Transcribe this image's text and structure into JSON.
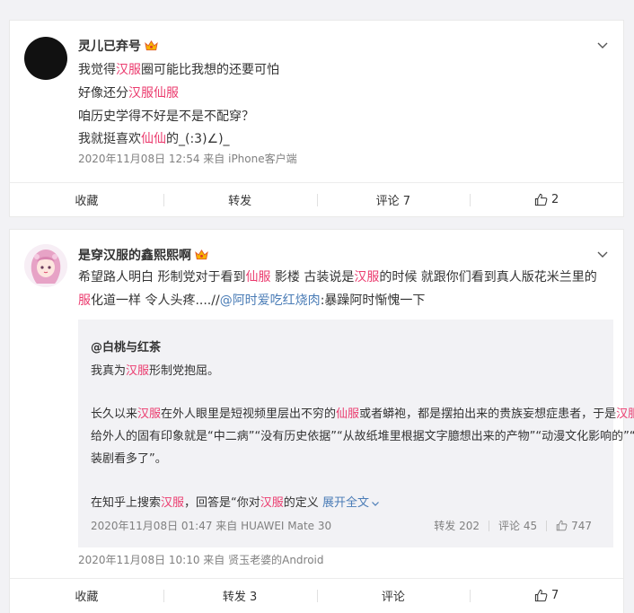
{
  "post1": {
    "username": "灵儿已弃号",
    "lines": [
      {
        "parts": [
          {
            "t": "我觉得"
          },
          {
            "t": "汉服",
            "hl": true
          },
          {
            "t": "圈可能比我想的还要可怕"
          }
        ]
      },
      {
        "parts": [
          {
            "t": "好像还分"
          },
          {
            "t": "汉服仙服",
            "hl": true
          }
        ]
      },
      {
        "parts": [
          {
            "t": "咱历史学得不好是不是不配穿？"
          }
        ]
      },
      {
        "parts": [
          {
            "t": "我就挺喜欢"
          },
          {
            "t": "仙仙",
            "hl": true
          },
          {
            "t": "的_(:3)∠)_"
          }
        ]
      }
    ],
    "meta": "2020年11月08日 12:54  来自 iPhone客户端",
    "actions": {
      "favorite": "收藏",
      "repost": "转发",
      "comment": "评论 7",
      "like": "2"
    }
  },
  "post2": {
    "username": "是穿汉服的鑫熙熙啊",
    "lines": [
      {
        "parts": [
          {
            "t": "希望路人明白 形制党对于看到"
          },
          {
            "t": "仙服",
            "hl": true
          },
          {
            "t": " 影楼 古装说是"
          },
          {
            "t": "汉服",
            "hl": true
          },
          {
            "t": "的时候 就跟你们看到真人版花米兰里的"
          }
        ]
      },
      {
        "parts": [
          {
            "t": "服",
            "hl": true
          },
          {
            "t": "化道一样 令人头疼....//"
          },
          {
            "t": "@阿时爱吃红烧肉",
            "link": true
          },
          {
            "t": ":暴躁阿时惭愧一下"
          }
        ]
      }
    ],
    "quote": {
      "username": "@白桃与红茶",
      "lines": [
        {
          "parts": [
            {
              "t": "我真为"
            },
            {
              "t": "汉服",
              "hl": true
            },
            {
              "t": "形制党抱屈。"
            }
          ]
        },
        {
          "parts": [
            {
              "t": "长久以来"
            },
            {
              "t": "汉服",
              "hl": true
            },
            {
              "t": "在外人眼里是短视频里层出不穷的"
            },
            {
              "t": "仙服",
              "hl": true
            },
            {
              "t": "或者蟒袍，都是摆拍出来的贵族妄想症患者，于是"
            },
            {
              "t": "汉服",
              "hl": true
            }
          ]
        },
        {
          "parts": [
            {
              "t": "给外人的固有印象就是“中二病”“没有历史依据”“从故纸堆里根据文字臆想出来的产物”“动漫文化影响的”“看古"
            }
          ]
        },
        {
          "parts": [
            {
              "t": "装剧看多了”。"
            }
          ]
        },
        {
          "parts": [
            {
              "t": "在知乎上搜索"
            },
            {
              "t": "汉服",
              "hl": true
            },
            {
              "t": "，回答是“你对"
            },
            {
              "t": "汉服",
              "hl": true
            },
            {
              "t": "的定义 "
            },
            {
              "t": "展开全文",
              "link": true
            }
          ]
        }
      ],
      "meta": "2020年11月08日 01:47 来自 HUAWEI Mate 30",
      "repost": "转发 202",
      "comment": "评论 45",
      "like": "747"
    },
    "meta": "2020年11月08日 10:10  来自 贤玉老婆的Android",
    "actions": {
      "favorite": "收藏",
      "repost": "转发 3",
      "comment": "评论",
      "like": "7"
    }
  },
  "colors": {
    "highlight": "#eb7350",
    "link": "#4a7cb6",
    "meta": "#808080",
    "background": "#f2f2f5"
  },
  "icons": {
    "more": "chevron-down-icon",
    "vip": "crown-icon",
    "like": "thumbs-up-icon",
    "expand": "chevron-down-icon"
  }
}
